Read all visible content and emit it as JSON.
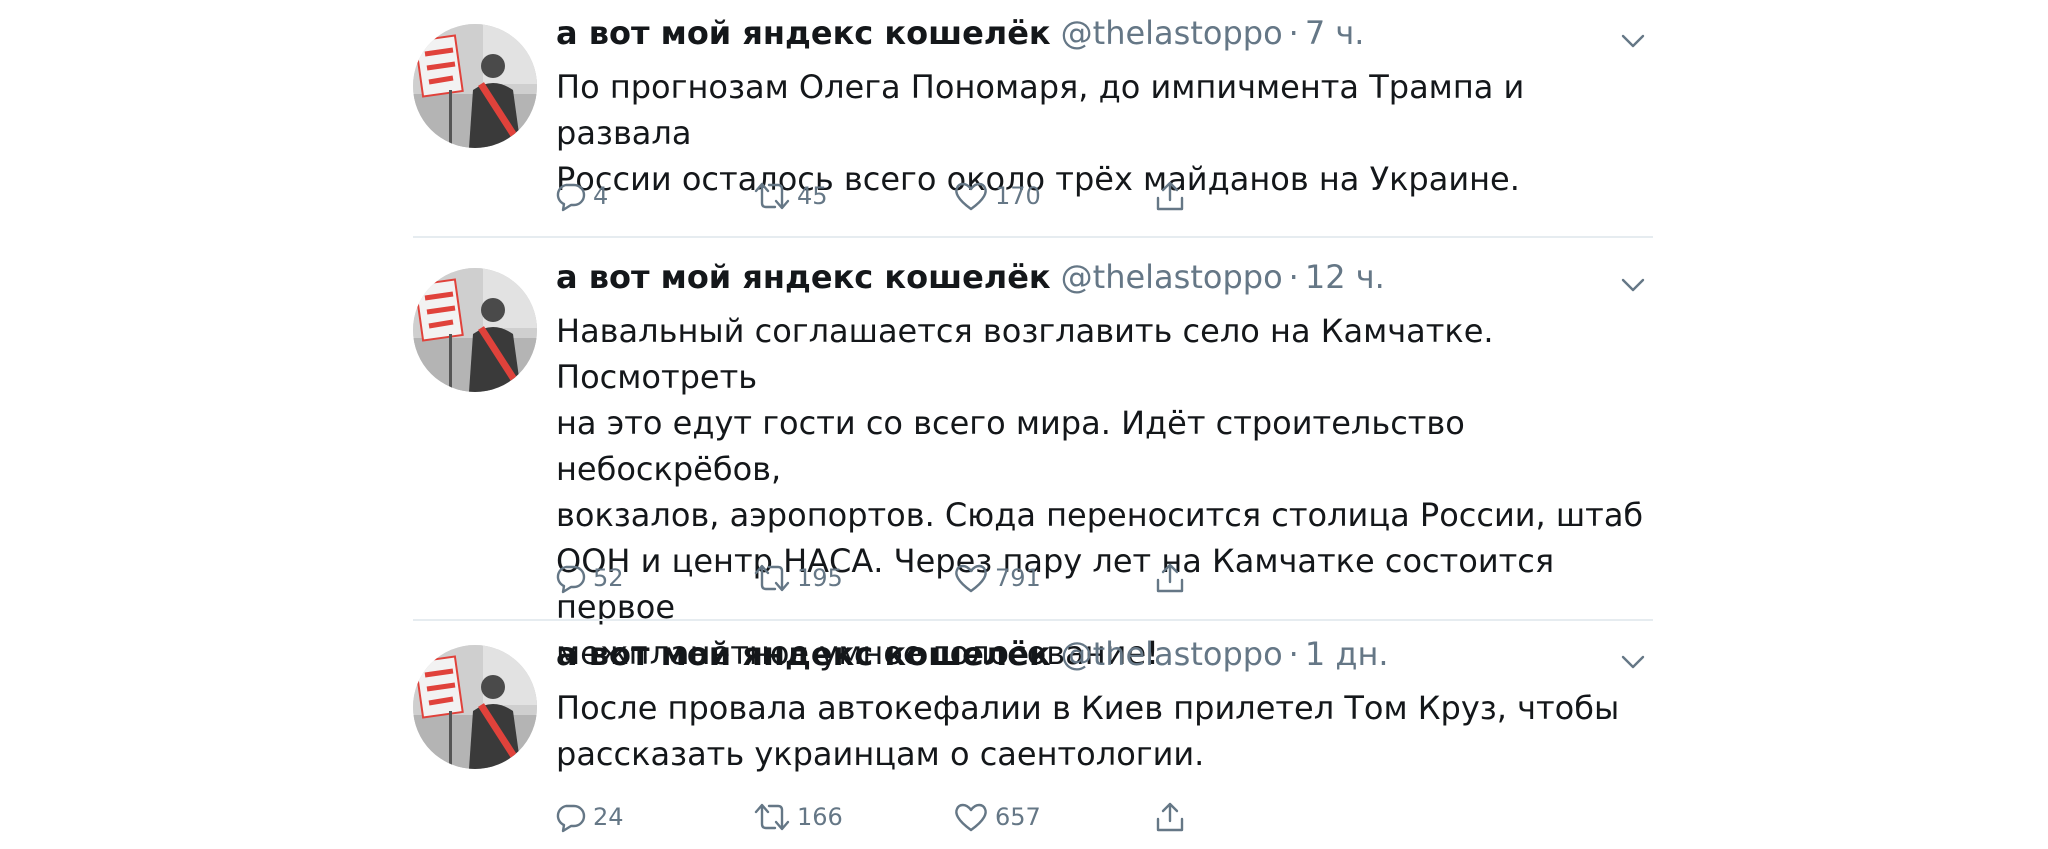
{
  "tweets": [
    {
      "author_name": "а вот мой яндекс кошелёк",
      "handle": "@thelastoppo",
      "separator": "·",
      "time": "7 ч.",
      "lines": [
        "По прогнозам Олега Пономаря, до импичмента Трампа и развала",
        "России осталось всего около трёх майданов на Украине."
      ],
      "replies": "4",
      "retweets": "45",
      "likes": "170"
    },
    {
      "author_name": "а вот мой яндекс кошелёк",
      "handle": "@thelastoppo",
      "separator": "·",
      "time": "12 ч.",
      "lines": [
        "Навальный соглашается возглавить село на Камчатке. Посмотреть",
        "на это едут гости со всего мира. Идёт строительство небоскрёбов,",
        "вокзалов, аэропортов. Сюда переносится столица России, штаб",
        "ООН и центр НАСА. Через пару лет на Камчатке состоится первое",
        "межпланетное умное голосование!"
      ],
      "replies": "52",
      "retweets": "195",
      "likes": "791"
    },
    {
      "author_name": "а вот мой яндекс кошелёк",
      "handle": "@thelastoppo",
      "separator": "·",
      "time": "1 дн.",
      "lines": [
        "После провала автокефалии в Киев прилетел Том Круз, чтобы",
        "рассказать украинцам о саентологии."
      ],
      "replies": "24",
      "retweets": "166",
      "likes": "657"
    }
  ],
  "avatar_sign_text": "ХОЧУ СРАТЬ",
  "colors": {
    "text": "#14171a",
    "secondary": "#657786",
    "divider": "#e6ecf0",
    "sign_red": "#e0423b"
  },
  "icons": [
    "reply-icon",
    "retweet-icon",
    "like-icon",
    "share-icon",
    "chevron-down-icon"
  ]
}
